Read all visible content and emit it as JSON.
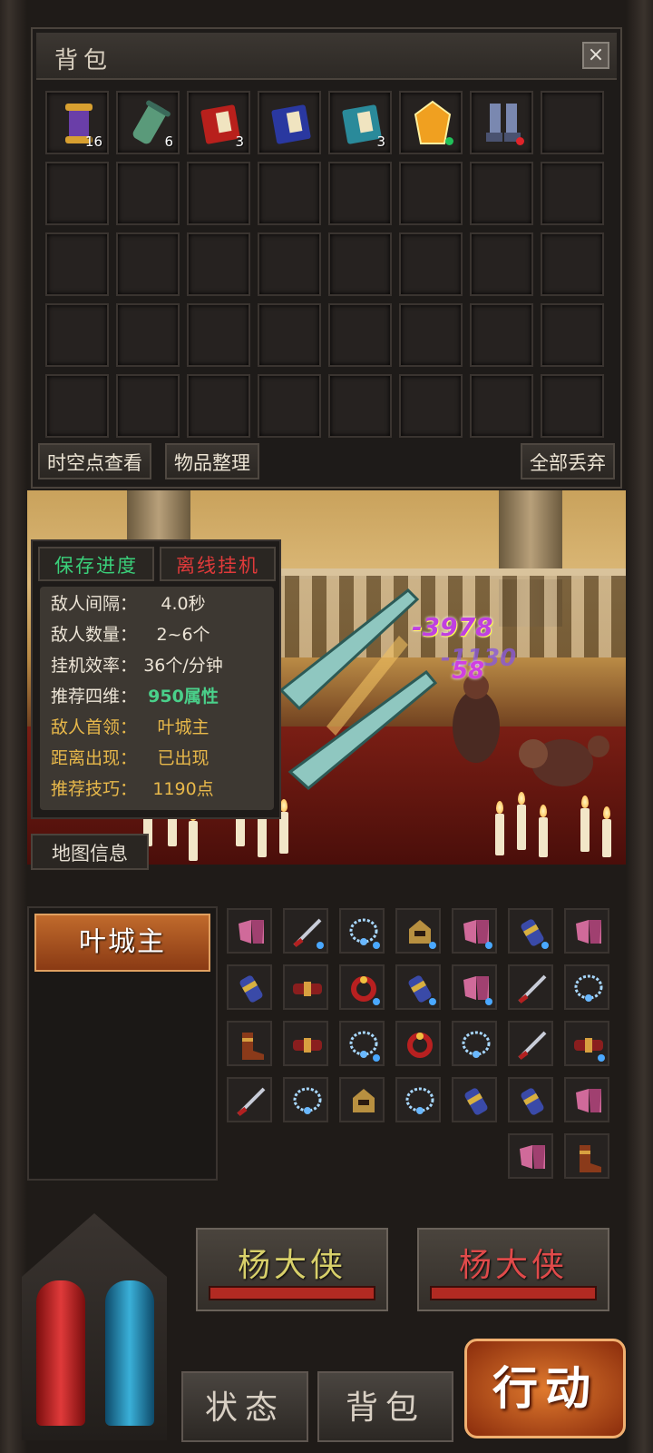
{
  "bag": {
    "title": "背包",
    "close_label": "×",
    "items": [
      {
        "icon": "scroll-purple-icon",
        "count": "16"
      },
      {
        "icon": "scroll-green-icon",
        "count": "6"
      },
      {
        "icon": "book-red-icon",
        "count": "3"
      },
      {
        "icon": "book-blue-icon",
        "count": ""
      },
      {
        "icon": "book-teal-icon",
        "count": "3"
      },
      {
        "icon": "gem-amber-icon",
        "count": "",
        "dot": "#21c15a"
      },
      {
        "icon": "boots-icon",
        "count": "",
        "dot": "#e0242a"
      }
    ],
    "buttons": {
      "spacetime": "时空点查看",
      "sort": "物品整理",
      "discard_all": "全部丢弃"
    }
  },
  "info": {
    "save_tab": "保存进度",
    "offline_tab": "离线挂机",
    "rows": [
      {
        "k": "敌人间隔：",
        "v": "4.0秒"
      },
      {
        "k": "敌人数量：",
        "v": "2~6个"
      },
      {
        "k": "挂机效率：",
        "v": "36个/分钟"
      },
      {
        "k": "推荐四维：",
        "v": "950属性"
      },
      {
        "k": "敌人首领：",
        "v": "叶城主"
      },
      {
        "k": "距离出现：",
        "v": "已出现"
      },
      {
        "k": "推荐技巧：",
        "v": "1190点"
      }
    ],
    "map_info": "地图信息"
  },
  "battle": {
    "damage_main": "-3978",
    "damage_overlap": "-1130",
    "damage_small": "58"
  },
  "boss": {
    "name": "叶城主"
  },
  "loot": [
    {
      "icon": "pink-armor-icon"
    },
    {
      "icon": "sword-icon",
      "dot": true
    },
    {
      "icon": "necklace-icon",
      "dot": true
    },
    {
      "icon": "helmet-icon",
      "dot": true
    },
    {
      "icon": "pink-armor-icon",
      "dot": true
    },
    {
      "icon": "bracer-icon",
      "dot": true
    },
    {
      "icon": "pink-armor-icon"
    },
    {
      "icon": "bracer-icon"
    },
    {
      "icon": "belt-icon"
    },
    {
      "icon": "ring-icon",
      "dot": true
    },
    {
      "icon": "bracer-icon",
      "dot": true
    },
    {
      "icon": "pink-armor-icon",
      "dot": true
    },
    {
      "icon": "sword-icon"
    },
    {
      "icon": "necklace-icon"
    },
    {
      "icon": "boots-icon"
    },
    {
      "icon": "belt-icon"
    },
    {
      "icon": "necklace-icon",
      "dot": true
    },
    {
      "icon": "ring-icon"
    },
    {
      "icon": "necklace-icon"
    },
    {
      "icon": "sword-icon"
    },
    {
      "icon": "belt-icon",
      "dot": true
    },
    {
      "icon": "sword-icon"
    },
    {
      "icon": "necklace-icon"
    },
    {
      "icon": "helmet-icon"
    },
    {
      "icon": "necklace-icon"
    },
    {
      "icon": "bracer-icon"
    },
    {
      "icon": "bracer-icon"
    },
    {
      "icon": "pink-armor-icon"
    },
    {
      "icon": "pink-armor-icon"
    },
    {
      "icon": "boots-icon"
    }
  ],
  "heroes": [
    {
      "name": "杨大侠",
      "color": "#d8d06a"
    },
    {
      "name": "杨大侠",
      "color": "#e04a4a"
    }
  ],
  "nav": {
    "status": "状态",
    "bag": "背包",
    "action": "行动"
  },
  "colors": {
    "save_tab": "#3ad07a",
    "offline_tab": "#e03a3a",
    "highlight": "#4ad08a",
    "gold": "#e8b84a"
  }
}
